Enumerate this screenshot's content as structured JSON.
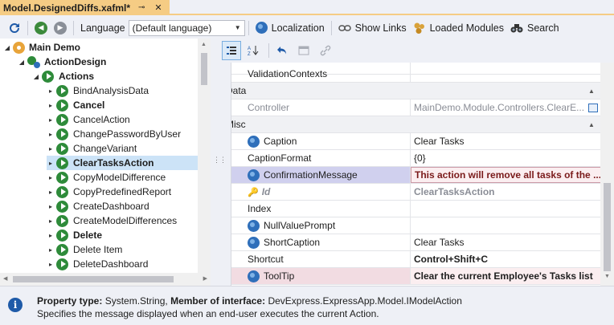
{
  "tab": {
    "title": "Model.DesignedDiffs.xafml*",
    "pin_glyph": "⊸",
    "close_glyph": "✕"
  },
  "toolbar": {
    "language_label": "Language",
    "language_value": "(Default language)",
    "localization": "Localization",
    "show_links": "Show Links",
    "loaded_modules": "Loaded Modules",
    "search": "Search"
  },
  "tree": {
    "root": "Main Demo",
    "action_design": "ActionDesign",
    "actions": "Actions",
    "items": [
      {
        "label": "BindAnalysisData",
        "bold": false
      },
      {
        "label": "Cancel",
        "bold": true
      },
      {
        "label": "CancelAction",
        "bold": false
      },
      {
        "label": "ChangePasswordByUser",
        "bold": false
      },
      {
        "label": "ChangeVariant",
        "bold": false
      },
      {
        "label": "ClearTasksAction",
        "bold": true
      },
      {
        "label": "CopyModelDifference",
        "bold": false
      },
      {
        "label": "CopyPredefinedReport",
        "bold": false
      },
      {
        "label": "CreateDashboard",
        "bold": false
      },
      {
        "label": "CreateModelDifferences",
        "bold": false
      },
      {
        "label": "Delete",
        "bold": true
      },
      {
        "label": "Delete Item",
        "bold": false
      },
      {
        "label": "DeleteDashboard",
        "bold": false
      }
    ],
    "selected_item": "ClearTasksAction"
  },
  "properties": {
    "partial_top_value": "",
    "validation_contexts": {
      "name": "ValidationContexts",
      "value": ""
    },
    "cat_data": "Data",
    "controller": {
      "name": "Controller",
      "value": "MainDemo.Module.Controllers.ClearE..."
    },
    "cat_misc": "Misc",
    "caption": {
      "name": "Caption",
      "value": "Clear Tasks"
    },
    "caption_format": {
      "name": "CaptionFormat",
      "value": "{0}"
    },
    "confirmation_message": {
      "name": "ConfirmationMessage",
      "value": "This action will remove all tasks of the ..."
    },
    "id": {
      "name": "Id",
      "value": "ClearTasksAction"
    },
    "index": {
      "name": "Index",
      "value": ""
    },
    "null_value_prompt": {
      "name": "NullValuePrompt",
      "value": ""
    },
    "short_caption": {
      "name": "ShortCaption",
      "value": "Clear Tasks"
    },
    "shortcut": {
      "name": "Shortcut",
      "value": "Control+Shift+C"
    },
    "tooltip": {
      "name": "ToolTip",
      "value": "Clear the current Employee's Tasks list"
    }
  },
  "description": {
    "property_type_label": "Property type:",
    "property_type_value": "System.String,",
    "member_label": "Member of interface:",
    "member_value": "DevExpress.ExpressApp.Model.IModelAction",
    "text": "Specifies the message displayed when an end-user executes the current Action."
  },
  "icons": [
    "refresh-icon",
    "back-icon",
    "forward-icon",
    "globe-icon",
    "link-icon",
    "modules-icon",
    "binoculars-icon",
    "info-icon"
  ],
  "colors": {
    "tab_accent": "#f5cc84",
    "selection": "#cce3f7",
    "changed_value": "#7a1a1a"
  }
}
